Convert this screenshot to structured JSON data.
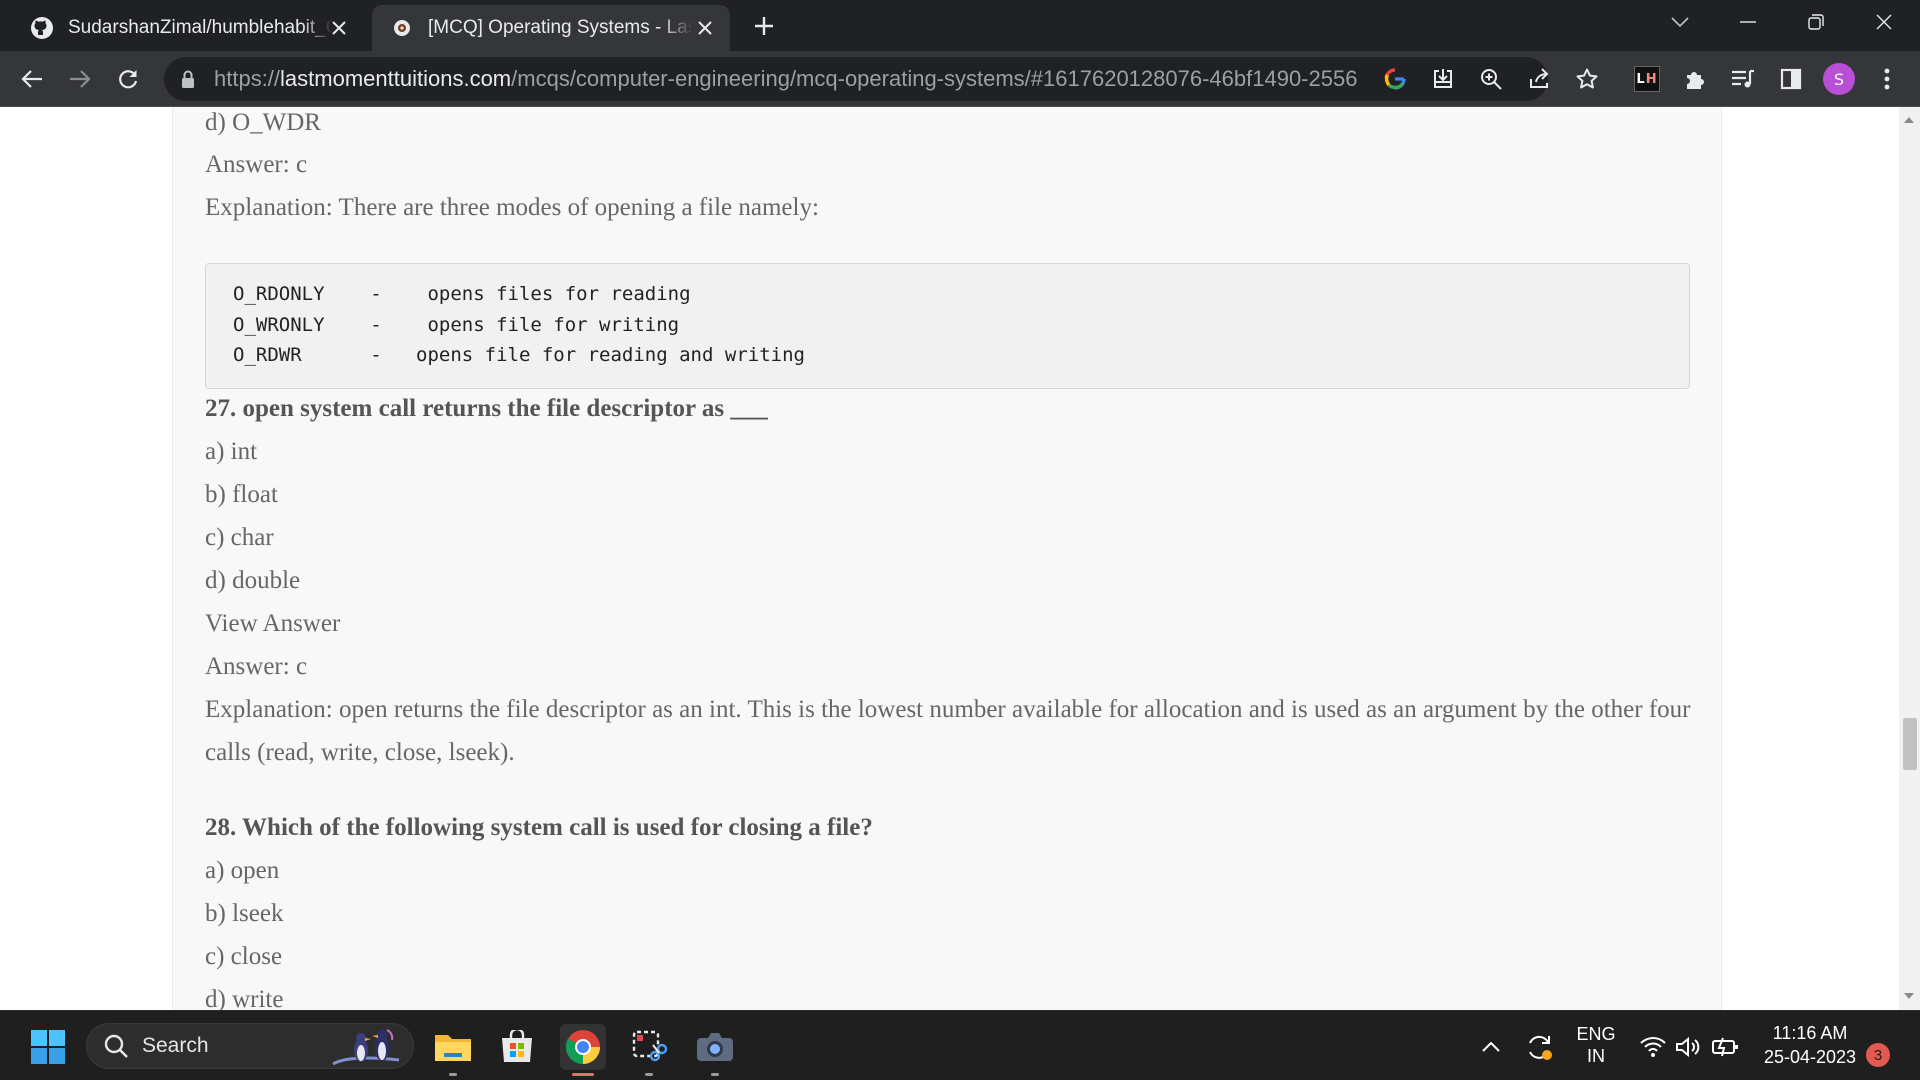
{
  "browser": {
    "tabs": [
      {
        "title": "SudarshanZimal/humblehabit_C-",
        "favicon": "github-icon",
        "active": false
      },
      {
        "title": "[MCQ] Operating Systems - Last Moment Tuitions",
        "favicon": "site-favicon-icon",
        "active": true
      }
    ],
    "url": {
      "scheme": "https://",
      "host": "lastmomenttuitions.com",
      "path": "/mcqs/computer-engineering/mcq-operating-systems/#1617620128076-46bf1490-2556"
    },
    "profile_initial": "S",
    "extension_label": {
      "l": "L",
      "h": "H"
    }
  },
  "page": {
    "lines": {
      "prev_option_d": "d) O_WDR",
      "prev_answer": "Answer: c",
      "prev_explanation": "Explanation: There are three modes of opening a file namely:",
      "q27": "27. open system call returns the file descriptor as ___",
      "q27_a": "a) int",
      "q27_b": "b) float",
      "q27_c": "c) char",
      "q27_d": "d) double",
      "q27_view": "View Answer",
      "q27_answer": "Answer: c",
      "q27_expl_1": "Explanation: open returns the file descriptor as an int. This is the lowest number available for allocation and is used as an argument by the other four",
      "q27_expl_2": "calls (read, write, close, lseek).",
      "q28": "28. Which of the following system call is used for closing a file?",
      "q28_a": "a) open",
      "q28_b": "b) lseek",
      "q28_c": "c) close",
      "q28_d": "d) write"
    },
    "code_block": [
      "O_RDONLY    -    opens files for reading",
      "O_WRONLY    -    opens file for writing",
      "O_RDWR      -   opens file for reading and writing"
    ]
  },
  "taskbar": {
    "search_label": "Search",
    "language": {
      "line1": "ENG",
      "line2": "IN"
    },
    "time": "11:16 AM",
    "date": "25-04-2023",
    "notification_count": "3"
  },
  "colors": {
    "tabstrip": "#202124",
    "toolbar": "#35363a",
    "page_column": "#f8f8f8",
    "taskbar": "#1f1f1f",
    "avatar": "#b94fd6"
  }
}
